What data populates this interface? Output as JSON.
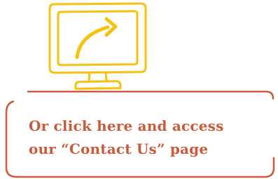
{
  "cta": {
    "line1": "Or click here and access",
    "line2": "our “Contact Us” page"
  },
  "icon": {
    "name": "monitor-arrow-icon"
  },
  "colors": {
    "icon": "#f5c20f",
    "accent": "#c75b3c",
    "background": "#ffffff"
  }
}
